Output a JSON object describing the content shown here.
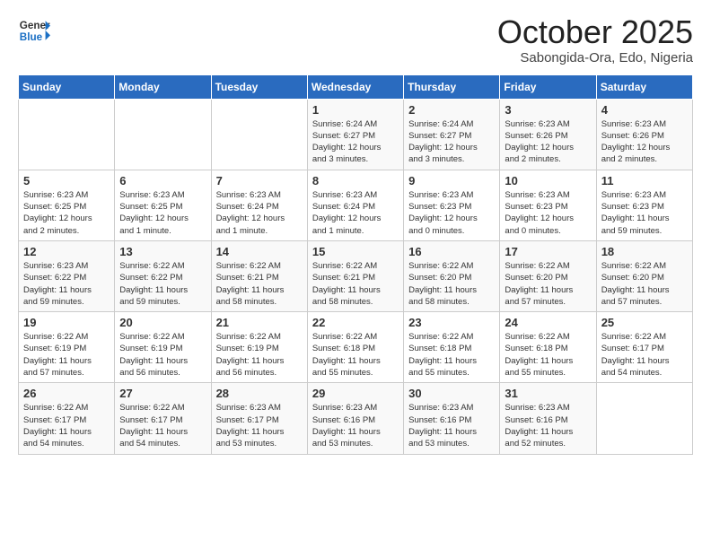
{
  "header": {
    "logo_general": "General",
    "logo_blue": "Blue",
    "month_title": "October 2025",
    "location": "Sabongida-Ora, Edo, Nigeria"
  },
  "weekdays": [
    "Sunday",
    "Monday",
    "Tuesday",
    "Wednesday",
    "Thursday",
    "Friday",
    "Saturday"
  ],
  "weeks": [
    [
      {
        "day": "",
        "info": ""
      },
      {
        "day": "",
        "info": ""
      },
      {
        "day": "",
        "info": ""
      },
      {
        "day": "1",
        "info": "Sunrise: 6:24 AM\nSunset: 6:27 PM\nDaylight: 12 hours\nand 3 minutes."
      },
      {
        "day": "2",
        "info": "Sunrise: 6:24 AM\nSunset: 6:27 PM\nDaylight: 12 hours\nand 3 minutes."
      },
      {
        "day": "3",
        "info": "Sunrise: 6:23 AM\nSunset: 6:26 PM\nDaylight: 12 hours\nand 2 minutes."
      },
      {
        "day": "4",
        "info": "Sunrise: 6:23 AM\nSunset: 6:26 PM\nDaylight: 12 hours\nand 2 minutes."
      }
    ],
    [
      {
        "day": "5",
        "info": "Sunrise: 6:23 AM\nSunset: 6:25 PM\nDaylight: 12 hours\nand 2 minutes."
      },
      {
        "day": "6",
        "info": "Sunrise: 6:23 AM\nSunset: 6:25 PM\nDaylight: 12 hours\nand 1 minute."
      },
      {
        "day": "7",
        "info": "Sunrise: 6:23 AM\nSunset: 6:24 PM\nDaylight: 12 hours\nand 1 minute."
      },
      {
        "day": "8",
        "info": "Sunrise: 6:23 AM\nSunset: 6:24 PM\nDaylight: 12 hours\nand 1 minute."
      },
      {
        "day": "9",
        "info": "Sunrise: 6:23 AM\nSunset: 6:23 PM\nDaylight: 12 hours\nand 0 minutes."
      },
      {
        "day": "10",
        "info": "Sunrise: 6:23 AM\nSunset: 6:23 PM\nDaylight: 12 hours\nand 0 minutes."
      },
      {
        "day": "11",
        "info": "Sunrise: 6:23 AM\nSunset: 6:23 PM\nDaylight: 11 hours\nand 59 minutes."
      }
    ],
    [
      {
        "day": "12",
        "info": "Sunrise: 6:23 AM\nSunset: 6:22 PM\nDaylight: 11 hours\nand 59 minutes."
      },
      {
        "day": "13",
        "info": "Sunrise: 6:22 AM\nSunset: 6:22 PM\nDaylight: 11 hours\nand 59 minutes."
      },
      {
        "day": "14",
        "info": "Sunrise: 6:22 AM\nSunset: 6:21 PM\nDaylight: 11 hours\nand 58 minutes."
      },
      {
        "day": "15",
        "info": "Sunrise: 6:22 AM\nSunset: 6:21 PM\nDaylight: 11 hours\nand 58 minutes."
      },
      {
        "day": "16",
        "info": "Sunrise: 6:22 AM\nSunset: 6:20 PM\nDaylight: 11 hours\nand 58 minutes."
      },
      {
        "day": "17",
        "info": "Sunrise: 6:22 AM\nSunset: 6:20 PM\nDaylight: 11 hours\nand 57 minutes."
      },
      {
        "day": "18",
        "info": "Sunrise: 6:22 AM\nSunset: 6:20 PM\nDaylight: 11 hours\nand 57 minutes."
      }
    ],
    [
      {
        "day": "19",
        "info": "Sunrise: 6:22 AM\nSunset: 6:19 PM\nDaylight: 11 hours\nand 57 minutes."
      },
      {
        "day": "20",
        "info": "Sunrise: 6:22 AM\nSunset: 6:19 PM\nDaylight: 11 hours\nand 56 minutes."
      },
      {
        "day": "21",
        "info": "Sunrise: 6:22 AM\nSunset: 6:19 PM\nDaylight: 11 hours\nand 56 minutes."
      },
      {
        "day": "22",
        "info": "Sunrise: 6:22 AM\nSunset: 6:18 PM\nDaylight: 11 hours\nand 55 minutes."
      },
      {
        "day": "23",
        "info": "Sunrise: 6:22 AM\nSunset: 6:18 PM\nDaylight: 11 hours\nand 55 minutes."
      },
      {
        "day": "24",
        "info": "Sunrise: 6:22 AM\nSunset: 6:18 PM\nDaylight: 11 hours\nand 55 minutes."
      },
      {
        "day": "25",
        "info": "Sunrise: 6:22 AM\nSunset: 6:17 PM\nDaylight: 11 hours\nand 54 minutes."
      }
    ],
    [
      {
        "day": "26",
        "info": "Sunrise: 6:22 AM\nSunset: 6:17 PM\nDaylight: 11 hours\nand 54 minutes."
      },
      {
        "day": "27",
        "info": "Sunrise: 6:22 AM\nSunset: 6:17 PM\nDaylight: 11 hours\nand 54 minutes."
      },
      {
        "day": "28",
        "info": "Sunrise: 6:23 AM\nSunset: 6:17 PM\nDaylight: 11 hours\nand 53 minutes."
      },
      {
        "day": "29",
        "info": "Sunrise: 6:23 AM\nSunset: 6:16 PM\nDaylight: 11 hours\nand 53 minutes."
      },
      {
        "day": "30",
        "info": "Sunrise: 6:23 AM\nSunset: 6:16 PM\nDaylight: 11 hours\nand 53 minutes."
      },
      {
        "day": "31",
        "info": "Sunrise: 6:23 AM\nSunset: 6:16 PM\nDaylight: 11 hours\nand 52 minutes."
      },
      {
        "day": "",
        "info": ""
      }
    ]
  ]
}
